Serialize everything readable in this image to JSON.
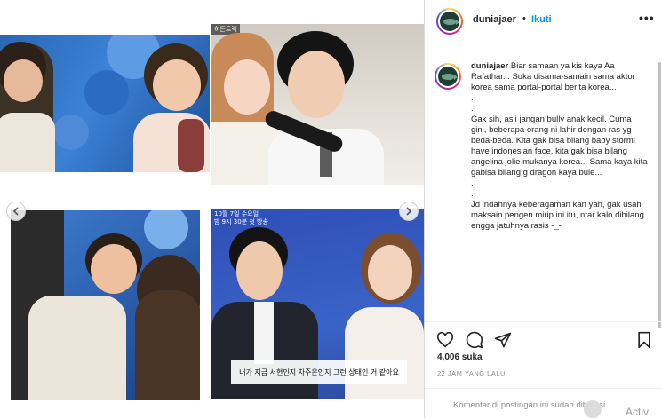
{
  "media": {
    "photo1_alt": "",
    "photo2_top_text": "히든트랙",
    "photo4_top_text": "10월 7일 수요일\n밤 9시 30분 첫 방송",
    "photo4_caption": "내가 지금 서현인지 차주은인지 그런 상태인 거 같아요",
    "nav_prev_icon": "chevron-left-icon",
    "nav_next_icon": "chevron-right-icon"
  },
  "header": {
    "username": "duniajaer",
    "separator": "•",
    "follow_label": "Ikuti",
    "more_label": "•••"
  },
  "caption": {
    "username": "duniajaer",
    "text": "Biar samaan ya kis kaya Aa Rafathar... Suka disama-samain sama aktor korea sama portal-portal berita korea...\n.\n.\nGak sih, asli jangan bully anak kecil. Cuma gini, beberapa orang ni lahir dengan ras yg beda-beda. Kita gak bisa bilang baby stormi have indonesian face, kita gak bisa bilang angelina jolie mukanya korea... Sama kaya kita gabisa bilang g dragon kaya bule...\n.\n.\nJd indahnya keberagaman kan yah, gak usah maksain pengen mirip ini itu, ntar kalo dibilang engga jatuhnya rasis -_-"
  },
  "actions": {
    "like_icon": "heart-icon",
    "comment_icon": "comment-icon",
    "share_icon": "share-icon",
    "save_icon": "bookmark-icon"
  },
  "likes": "4,006 suka",
  "timestamp": "22 JAM YANG LALU",
  "comments_disabled": "Komentar di postingan ini sudah dibatasi.",
  "overlay": {
    "activate_text": "Activ"
  },
  "colors": {
    "accent": "#0095f6",
    "text": "#262626",
    "muted": "#8e8e8e",
    "border": "#dbdbdb"
  }
}
